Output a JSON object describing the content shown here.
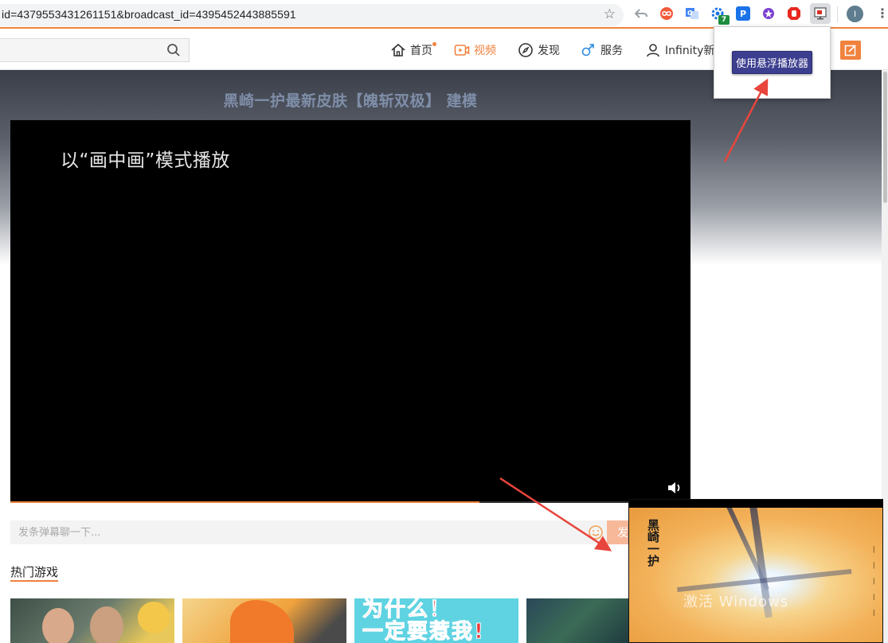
{
  "browser": {
    "url": "id=4379553431261151&broadcast_id=4395452443885591",
    "extension_badge": "7",
    "profile_initial": "I",
    "extensions": [
      "back-arrow-icon",
      "infinity-icon",
      "translate-icon",
      "gear-icon",
      "parking-icon",
      "star-badge-icon",
      "hand-stop-icon",
      "pip-icon"
    ]
  },
  "site_nav": {
    "items": [
      {
        "label": "首页",
        "icon": "home-icon"
      },
      {
        "label": "视频",
        "icon": "video-icon",
        "active": true
      },
      {
        "label": "发现",
        "icon": "compass-icon"
      },
      {
        "label": "服务",
        "icon": "male-icon"
      },
      {
        "label": "Infinity新标",
        "icon": "user-icon"
      }
    ]
  },
  "video": {
    "title": "黑崎一护最新皮肤【魄斩双极】 建模",
    "overlay_message": "以“画中画”模式播放",
    "progress": 0.69
  },
  "danmaku": {
    "placeholder": "发条弹幕聊一下...",
    "send_label": "发"
  },
  "section": {
    "title": "热门游戏"
  },
  "thumbnails": {
    "caption_line1": "为什么！",
    "caption_line2": "一定要惹我!"
  },
  "extension_popup": {
    "button_label": "使用悬浮播放器"
  },
  "pip_window": {
    "watermark": "激活 Windows"
  },
  "colors": {
    "accent": "#f0823e",
    "popup_button": "#3c3e8f",
    "annotation_arrow": "#e8453c"
  }
}
